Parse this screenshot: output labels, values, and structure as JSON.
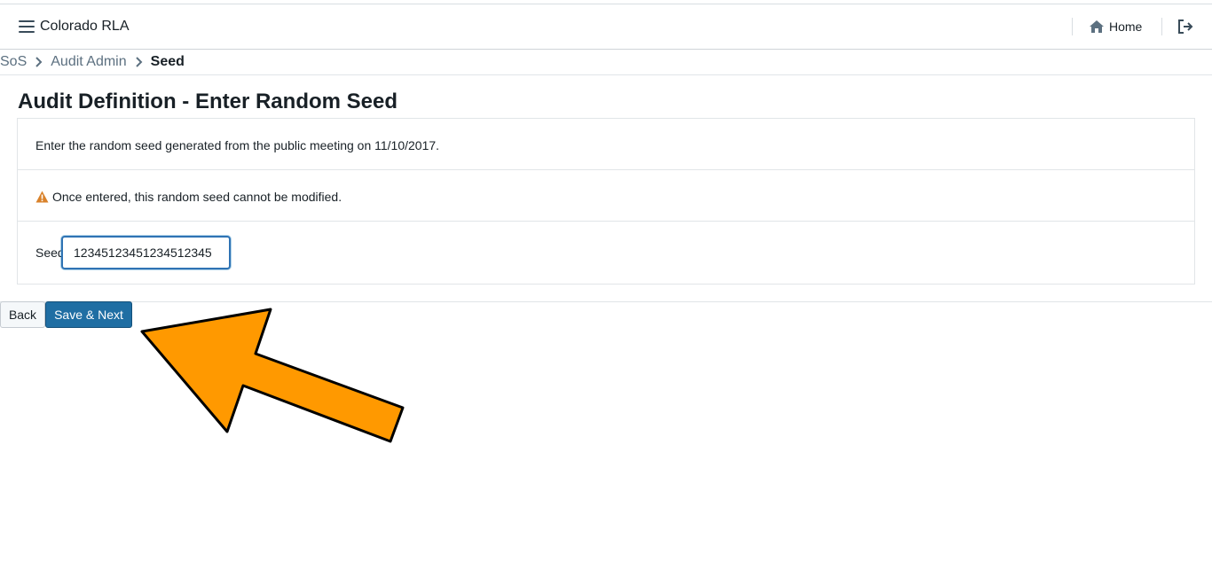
{
  "navbar": {
    "brand": "Colorado RLA",
    "home_label": "Home"
  },
  "breadcrumb": {
    "items": [
      "SoS",
      "Audit Admin"
    ],
    "current": "Seed"
  },
  "page": {
    "title": "Audit Definition - Enter Random Seed",
    "instruction": "Enter the random seed generated from the public meeting on 11/10/2017.",
    "warning": "Once entered, this random seed cannot be modified.",
    "seed_label": "Seed",
    "seed_value": "12345123451234512345"
  },
  "buttons": {
    "back": "Back",
    "save_next": "Save & Next"
  },
  "colors": {
    "primary": "#1f6ea3",
    "warning": "#d9822b",
    "annotation_arrow": "#ff9900"
  },
  "icons": [
    "menu-icon",
    "home-icon",
    "logout-icon",
    "chevron-right-icon",
    "warning-icon"
  ]
}
